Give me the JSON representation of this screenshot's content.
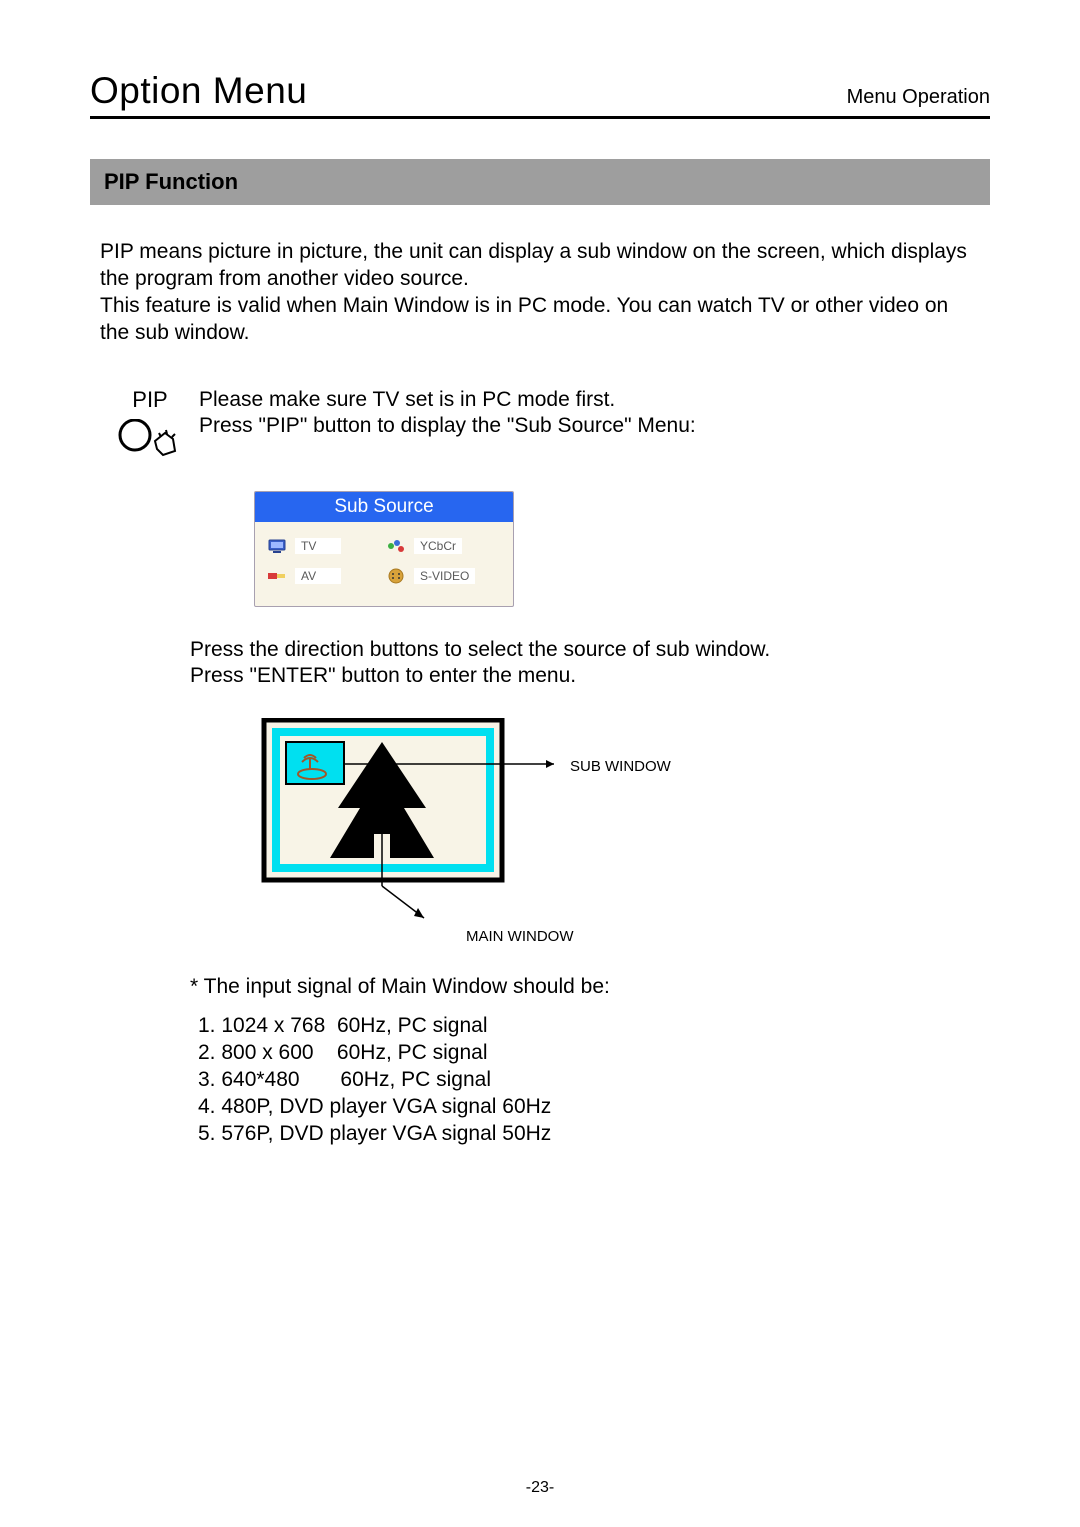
{
  "header": {
    "title": "Option Menu",
    "category": "Menu Operation"
  },
  "section": {
    "heading": "PIP Function",
    "intro": "PIP means picture in picture, the unit can display a sub window on the screen, which displays the program from another video source.\nThis feature is valid when Main Window is in PC mode. You can watch TV or other video on the sub window."
  },
  "pip": {
    "label": "PIP",
    "instructions": "Please make sure TV set is in PC mode first.\nPress \"PIP\" button to display the \"Sub Source\" Menu:"
  },
  "sub_source": {
    "title": "Sub Source",
    "items": [
      {
        "label": "TV"
      },
      {
        "label": "YCbCr"
      },
      {
        "label": "AV"
      },
      {
        "label": "S-VIDEO"
      }
    ]
  },
  "after_sub": "Press the direction buttons to select the source of sub window.\nPress \"ENTER\" button to enter the menu.",
  "diagram": {
    "sub_window_label": "SUB WINDOW",
    "main_window_label": "MAIN WINDOW"
  },
  "signals": {
    "note": "* The input signal of Main Window should be:",
    "list": [
      "1. 1024 x 768  60Hz, PC signal",
      "2. 800 x 600    60Hz, PC signal",
      "3. 640*480       60Hz, PC signal",
      "4. 480P, DVD player VGA signal 60Hz",
      "5. 576P, DVD player VGA signal 50Hz"
    ]
  },
  "page_number": "-23-"
}
